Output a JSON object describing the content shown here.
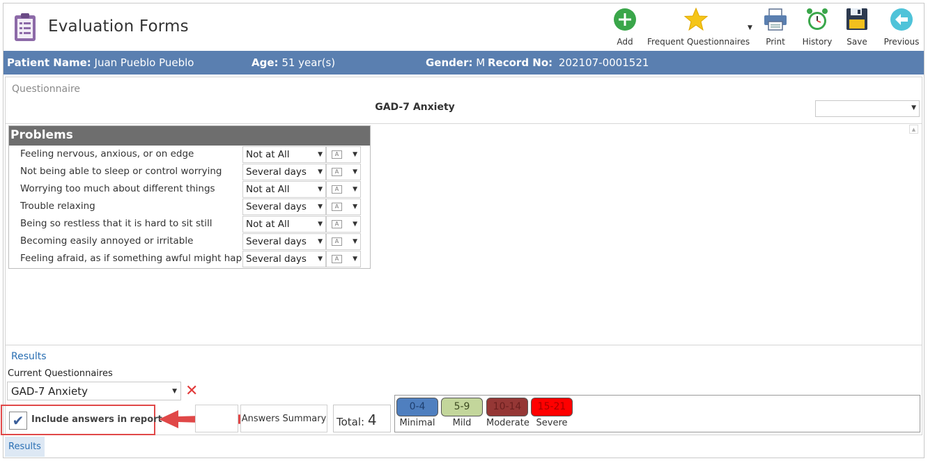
{
  "app": {
    "title": "Evaluation Forms"
  },
  "toolbar": {
    "add": "Add",
    "frequent": "Frequent Questionnaires",
    "print": "Print",
    "history": "History",
    "save": "Save",
    "previous": "Previous"
  },
  "patient": {
    "name_label": "Patient Name:",
    "name": "Juan Pueblo Pueblo",
    "age_label": "Age:",
    "age": "51 year(s)",
    "gender_label": "Gender:",
    "gender": "M",
    "record_label": "Record No:",
    "record": "202107-0001521"
  },
  "questionnaire": {
    "label": "Questionnaire",
    "title": "GAD-7 Anxiety",
    "select_value": ""
  },
  "problems": {
    "heading": "Problems",
    "items": [
      {
        "text": "Feeling nervous, anxious, or on edge",
        "answer": "Not at All"
      },
      {
        "text": "Not being able to sleep or control worrying",
        "answer": "Several days"
      },
      {
        "text": "Worrying too much about different things",
        "answer": "Not at All"
      },
      {
        "text": "Trouble relaxing",
        "answer": "Several days"
      },
      {
        "text": "Being so restless that it is hard to sit still",
        "answer": "Not at All"
      },
      {
        "text": "Becoming easily annoyed or irritable",
        "answer": "Several days"
      },
      {
        "text": "Feeling afraid, as if something awful might happen",
        "answer": "Several days"
      }
    ]
  },
  "results": {
    "label": "Results",
    "current_label": "Current Questionnaires",
    "current_value": "GAD-7 Anxiety",
    "include_label": "Include answers in report",
    "include_checked": true,
    "answers_summary": "Answers Summary",
    "total_label": "Total:",
    "total_value": "4",
    "scores": [
      {
        "range": "0-4",
        "caption": "Minimal",
        "color": "#4f7fbf",
        "text_color": "#1f3f6f"
      },
      {
        "range": "5-9",
        "caption": "Mild",
        "color": "#c3d69b",
        "text_color": "#3c4a20"
      },
      {
        "range": "10-14",
        "caption": "Moderate",
        "color": "#953735",
        "text_color": "#6a1f1e"
      },
      {
        "range": "15-21",
        "caption": "Severe",
        "color": "#ff0000",
        "text_color": "#a80000"
      }
    ]
  },
  "bottom_tab": "Results",
  "colors": {
    "patient_bar": "#5a7fb0",
    "accent": "#2a6fb3",
    "highlight": "#e04848"
  }
}
